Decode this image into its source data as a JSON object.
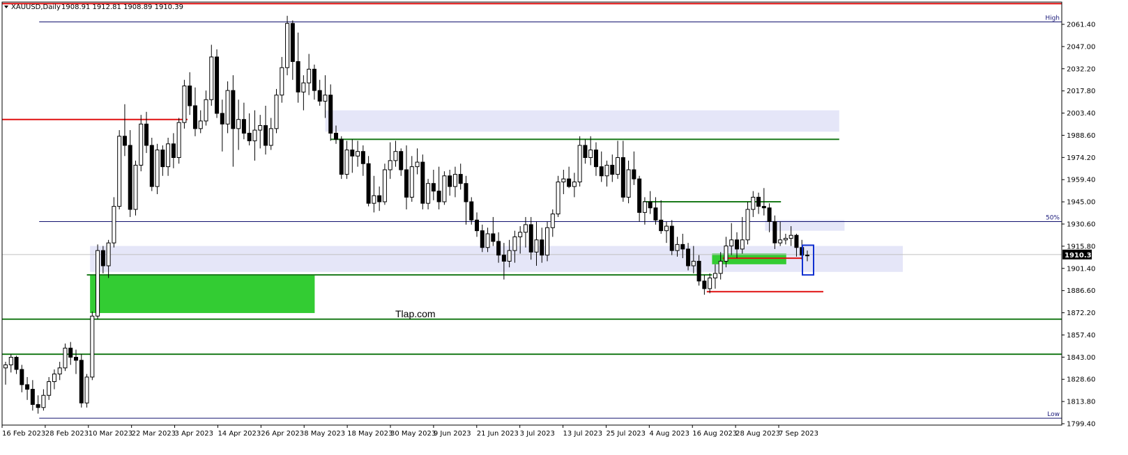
{
  "header": {
    "symbol_label": "XAUUSD,Daily",
    "ohlc_text": "1908.91 1912.81 1908.89 1910.39"
  },
  "watermark": "Tlap.com",
  "current_price": "1910.39",
  "colors": {
    "background": "#ffffff",
    "candle": "#000000",
    "zone_lavender": "#e5e6f8",
    "zone_green": "#33cc33",
    "line_green": "#1a7a1a",
    "line_red": "#e01010",
    "line_navy": "#10106e",
    "highlight_box": "#1030d0"
  },
  "chart_data": {
    "type": "candlestick",
    "symbol": "XAUUSD",
    "timeframe": "Daily",
    "y_ticks": [
      "2061.40",
      "2047.00",
      "2032.20",
      "2017.80",
      "2003.40",
      "1988.60",
      "1974.20",
      "1959.40",
      "1945.00",
      "1930.60",
      "1915.80",
      "1901.40",
      "1886.60",
      "1872.20",
      "1857.40",
      "1843.00",
      "1828.60",
      "1813.80",
      "1799.40"
    ],
    "ylim": [
      1799.4,
      2061.4
    ],
    "x_ticks": [
      "16 Feb 2023",
      "28 Feb 2023",
      "10 Mar 2023",
      "22 Mar 2023",
      "3 Apr 2023",
      "14 Apr 2023",
      "26 Apr 2023",
      "8 May 2023",
      "18 May 2023",
      "30 May 2023",
      "9 Jun 2023",
      "21 Jun 2023",
      "3 Jul 2023",
      "13 Jul 2023",
      "25 Jul 2023",
      "4 Aug 2023",
      "16 Aug 2023",
      "28 Aug 2023",
      "7 Sep 2023"
    ],
    "candles": [
      [
        1836,
        1840,
        1825,
        1838
      ],
      [
        1838,
        1845,
        1833,
        1843
      ],
      [
        1843,
        1844,
        1832,
        1835
      ],
      [
        1835,
        1838,
        1820,
        1825
      ],
      [
        1825,
        1830,
        1815,
        1822
      ],
      [
        1822,
        1828,
        1808,
        1812
      ],
      [
        1812,
        1818,
        1806,
        1810
      ],
      [
        1810,
        1822,
        1808,
        1818
      ],
      [
        1818,
        1830,
        1815,
        1827
      ],
      [
        1827,
        1835,
        1822,
        1832
      ],
      [
        1832,
        1840,
        1828,
        1836
      ],
      [
        1836,
        1852,
        1834,
        1849
      ],
      [
        1849,
        1853,
        1838,
        1843
      ],
      [
        1843,
        1848,
        1832,
        1841
      ],
      [
        1841,
        1845,
        1810,
        1813
      ],
      [
        1813,
        1832,
        1810,
        1830
      ],
      [
        1830,
        1873,
        1828,
        1870
      ],
      [
        1870,
        1917,
        1868,
        1913
      ],
      [
        1913,
        1916,
        1898,
        1903
      ],
      [
        1903,
        1920,
        1895,
        1918
      ],
      [
        1918,
        1948,
        1915,
        1942
      ],
      [
        1942,
        1992,
        1940,
        1988
      ],
      [
        1988,
        2009,
        1975,
        1982
      ],
      [
        1982,
        1992,
        1935,
        1940
      ],
      [
        1940,
        1972,
        1936,
        1969
      ],
      [
        1969,
        2002,
        1965,
        1996
      ],
      [
        1996,
        2004,
        1977,
        1982
      ],
      [
        1982,
        1987,
        1952,
        1955
      ],
      [
        1955,
        1983,
        1950,
        1979
      ],
      [
        1979,
        1982,
        1962,
        1968
      ],
      [
        1968,
        1987,
        1962,
        1983
      ],
      [
        1983,
        1990,
        1967,
        1974
      ],
      [
        1974,
        2000,
        1970,
        1997
      ],
      [
        1997,
        2025,
        1993,
        2021
      ],
      [
        2021,
        2030,
        2002,
        2008
      ],
      [
        2008,
        2020,
        1988,
        1993
      ],
      [
        1993,
        2005,
        1990,
        1998
      ],
      [
        1998,
        2018,
        1995,
        2012
      ],
      [
        2012,
        2048,
        2008,
        2040
      ],
      [
        2040,
        2045,
        2000,
        2003
      ],
      [
        2003,
        2012,
        1978,
        1996
      ],
      [
        1996,
        2024,
        1990,
        2018
      ],
      [
        2018,
        2028,
        1968,
        1993
      ],
      [
        1993,
        2012,
        1979,
        1999
      ],
      [
        1999,
        2010,
        1986,
        1990
      ],
      [
        1990,
        2003,
        1982,
        1985
      ],
      [
        1985,
        2005,
        1972,
        1992
      ],
      [
        1992,
        2002,
        1980,
        1995
      ],
      [
        1995,
        2008,
        1976,
        1982
      ],
      [
        1982,
        2000,
        1979,
        1993
      ],
      [
        1993,
        2019,
        1990,
        2015
      ],
      [
        2015,
        2040,
        2010,
        2033
      ],
      [
        2033,
        2067,
        2028,
        2062
      ],
      [
        2062,
        2064,
        2025,
        2037
      ],
      [
        2037,
        2056,
        2010,
        2017
      ],
      [
        2017,
        2028,
        2005,
        2023
      ],
      [
        2023,
        2042,
        2015,
        2032
      ],
      [
        2032,
        2035,
        2012,
        2018
      ],
      [
        2018,
        2025,
        2008,
        2011
      ],
      [
        2011,
        2028,
        2000,
        2015
      ],
      [
        2015,
        2022,
        1985,
        1990
      ],
      [
        1990,
        1995,
        1983,
        1986
      ],
      [
        1986,
        1988,
        1960,
        1963
      ],
      [
        1963,
        1985,
        1960,
        1979
      ],
      [
        1979,
        1986,
        1964,
        1975
      ],
      [
        1975,
        1985,
        1968,
        1978
      ],
      [
        1978,
        1982,
        1962,
        1970
      ],
      [
        1970,
        1975,
        1942,
        1944
      ],
      [
        1944,
        1962,
        1938,
        1949
      ],
      [
        1949,
        1955,
        1939,
        1945
      ],
      [
        1945,
        1970,
        1943,
        1966
      ],
      [
        1966,
        1984,
        1960,
        1972
      ],
      [
        1972,
        1985,
        1968,
        1978
      ],
      [
        1978,
        1980,
        1962,
        1966
      ],
      [
        1966,
        1982,
        1940,
        1948
      ],
      [
        1948,
        1975,
        1945,
        1968
      ],
      [
        1968,
        1980,
        1963,
        1971
      ],
      [
        1971,
        1976,
        1940,
        1944
      ],
      [
        1944,
        1960,
        1940,
        1957
      ],
      [
        1957,
        1966,
        1946,
        1952
      ],
      [
        1952,
        1968,
        1940,
        1945
      ],
      [
        1945,
        1965,
        1943,
        1962
      ],
      [
        1962,
        1966,
        1949,
        1955
      ],
      [
        1955,
        1968,
        1948,
        1963
      ],
      [
        1963,
        1970,
        1953,
        1957
      ],
      [
        1957,
        1962,
        1930,
        1945
      ],
      [
        1945,
        1948,
        1930,
        1933
      ],
      [
        1933,
        1938,
        1922,
        1926
      ],
      [
        1926,
        1930,
        1912,
        1915
      ],
      [
        1915,
        1928,
        1912,
        1924
      ],
      [
        1924,
        1935,
        1916,
        1919
      ],
      [
        1919,
        1925,
        1905,
        1910
      ],
      [
        1910,
        1918,
        1894,
        1906
      ],
      [
        1906,
        1920,
        1902,
        1913
      ],
      [
        1913,
        1926,
        1905,
        1922
      ],
      [
        1922,
        1929,
        1911,
        1925
      ],
      [
        1925,
        1935,
        1915,
        1930
      ],
      [
        1930,
        1935,
        1907,
        1912
      ],
      [
        1912,
        1932,
        1903,
        1920
      ],
      [
        1920,
        1928,
        1905,
        1910
      ],
      [
        1910,
        1932,
        1906,
        1928
      ],
      [
        1928,
        1940,
        1922,
        1937
      ],
      [
        1937,
        1962,
        1935,
        1958
      ],
      [
        1958,
        1966,
        1950,
        1960
      ],
      [
        1960,
        1968,
        1954,
        1955
      ],
      [
        1955,
        1964,
        1948,
        1958
      ],
      [
        1958,
        1988,
        1955,
        1982
      ],
      [
        1982,
        1986,
        1970,
        1974
      ],
      [
        1974,
        1988,
        1969,
        1979
      ],
      [
        1979,
        1984,
        1962,
        1968
      ],
      [
        1968,
        1978,
        1958,
        1962
      ],
      [
        1962,
        1972,
        1955,
        1969
      ],
      [
        1969,
        1976,
        1958,
        1963
      ],
      [
        1963,
        1985,
        1960,
        1974
      ],
      [
        1974,
        1985,
        1945,
        1948
      ],
      [
        1948,
        1972,
        1944,
        1966
      ],
      [
        1966,
        1978,
        1956,
        1960
      ],
      [
        1960,
        1962,
        1932,
        1938
      ],
      [
        1938,
        1948,
        1930,
        1945
      ],
      [
        1945,
        1952,
        1937,
        1941
      ],
      [
        1941,
        1948,
        1930,
        1933
      ],
      [
        1933,
        1946,
        1924,
        1926
      ],
      [
        1926,
        1932,
        1918,
        1929
      ],
      [
        1929,
        1933,
        1910,
        1913
      ],
      [
        1913,
        1922,
        1909,
        1917
      ],
      [
        1917,
        1924,
        1908,
        1914
      ],
      [
        1914,
        1918,
        1900,
        1903
      ],
      [
        1903,
        1916,
        1898,
        1906
      ],
      [
        1906,
        1910,
        1890,
        1893
      ],
      [
        1893,
        1897,
        1884,
        1888
      ],
      [
        1888,
        1898,
        1885,
        1895
      ],
      [
        1895,
        1904,
        1888,
        1898
      ],
      [
        1898,
        1912,
        1894,
        1906
      ],
      [
        1906,
        1922,
        1902,
        1916
      ],
      [
        1916,
        1931,
        1910,
        1920
      ],
      [
        1920,
        1925,
        1908,
        1914
      ],
      [
        1914,
        1935,
        1911,
        1920
      ],
      [
        1920,
        1945,
        1917,
        1940
      ],
      [
        1940,
        1952,
        1935,
        1948
      ],
      [
        1948,
        1951,
        1937,
        1942
      ],
      [
        1942,
        1954,
        1936,
        1941
      ],
      [
        1941,
        1944,
        1925,
        1932
      ],
      [
        1932,
        1936,
        1914,
        1918
      ],
      [
        1918,
        1932,
        1916,
        1920
      ],
      [
        1920,
        1924,
        1917,
        1921
      ],
      [
        1921,
        1929,
        1916,
        1923
      ],
      [
        1923,
        1924,
        1909,
        1915
      ],
      [
        1915,
        1920,
        1907,
        1910
      ],
      [
        1910,
        1913,
        1906,
        1910
      ]
    ],
    "levels": [
      {
        "kind": "line",
        "color": "red",
        "price": 2075.0,
        "from": 0.0,
        "to": 1.0
      },
      {
        "kind": "line",
        "color": "navy",
        "price": 2063.0,
        "from": 0.035,
        "to": 1.0,
        "label": "High"
      },
      {
        "kind": "line",
        "color": "red",
        "price": 1999.0,
        "from": 0.0,
        "to": 0.175
      },
      {
        "kind": "line",
        "color": "green",
        "price": 1986.0,
        "from": 0.31,
        "to": 0.79
      },
      {
        "kind": "line",
        "color": "green",
        "price": 1945.0,
        "from": 0.605,
        "to": 0.735
      },
      {
        "kind": "line",
        "color": "navy",
        "price": 1932.0,
        "from": 0.035,
        "to": 1.0,
        "label": "50%"
      },
      {
        "kind": "line",
        "color": "green",
        "price": 1897.0,
        "from": 0.08,
        "to": 0.67
      },
      {
        "kind": "line",
        "color": "red",
        "price": 1908.0,
        "from": 0.68,
        "to": 0.755
      },
      {
        "kind": "line",
        "color": "red",
        "price": 1886.0,
        "from": 0.665,
        "to": 0.775
      },
      {
        "kind": "line",
        "color": "green",
        "price": 1868.0,
        "from": 0.0,
        "to": 1.0
      },
      {
        "kind": "line",
        "color": "green",
        "price": 1845.0,
        "from": 0.0,
        "to": 1.0
      },
      {
        "kind": "line",
        "color": "navy",
        "price": 1803.0,
        "from": 0.035,
        "to": 1.0,
        "label": "Low"
      }
    ],
    "zones": [
      {
        "color": "lavender",
        "top": 2005.0,
        "bottom": 1991.0,
        "from": 0.305,
        "to": 0.79
      },
      {
        "color": "lavender",
        "top": 1933.0,
        "bottom": 1926.0,
        "from": 0.72,
        "to": 0.795
      },
      {
        "color": "lavender",
        "top": 1916.0,
        "bottom": 1899.0,
        "from": 0.083,
        "to": 0.85
      },
      {
        "color": "green",
        "top": 1897.0,
        "bottom": 1872.0,
        "from": 0.083,
        "to": 0.295
      },
      {
        "color": "green",
        "top": 1911.0,
        "bottom": 1904.0,
        "from": 0.67,
        "to": 0.74
      }
    ]
  }
}
